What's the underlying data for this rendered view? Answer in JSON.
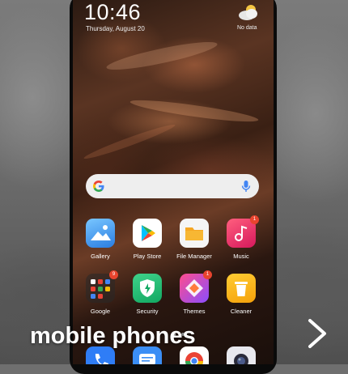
{
  "status": {
    "time": "10:46",
    "date": "Thursday, August 20",
    "weather": "No data"
  },
  "apps_row1": [
    {
      "label": "Gallery",
      "icon": "gallery-icon",
      "badge": ""
    },
    {
      "label": "Play Store",
      "icon": "play-store-icon",
      "badge": ""
    },
    {
      "label": "File Manager",
      "icon": "folder-icon",
      "badge": ""
    },
    {
      "label": "Music",
      "icon": "music-icon",
      "badge": "1"
    }
  ],
  "apps_row2": [
    {
      "label": "Google",
      "icon": "google-folder-icon",
      "badge": "9"
    },
    {
      "label": "Security",
      "icon": "shield-icon",
      "badge": ""
    },
    {
      "label": "Themes",
      "icon": "themes-icon",
      "badge": "1"
    },
    {
      "label": "Cleaner",
      "icon": "trash-icon",
      "badge": ""
    }
  ],
  "dock": [
    "phone-icon",
    "messages-icon",
    "chrome-icon",
    "camera-icon"
  ],
  "caption": "mobile phones",
  "colors": {
    "badge": "#e8442e",
    "search_bar": "#eeeeee"
  }
}
